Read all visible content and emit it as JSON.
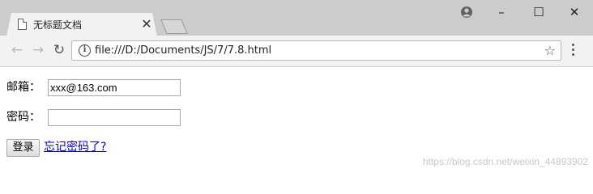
{
  "tab": {
    "title": "无标题文档",
    "close_glyph": "✕"
  },
  "window_controls": {
    "minimize": "–",
    "maximize": "☐",
    "close": "✕"
  },
  "toolbar": {
    "back_glyph": "←",
    "forward_glyph": "→",
    "reload_glyph": "↻",
    "info_glyph": "i",
    "url": "file:///D:/Documents/JS/7/7.8.html",
    "star_glyph": "☆"
  },
  "form": {
    "email_label": "邮箱：",
    "email_value": "xxx@163.com",
    "password_label": "密码：",
    "password_value": "",
    "login_label": "登录",
    "forgot_link": "忘记密码了?"
  },
  "watermark": "https://blog.csdn.net/weixin_44893902",
  "icons": {
    "tab_icon": "document-icon",
    "profile": "account-circle-icon",
    "menu": "more-vertical-icon",
    "info": "info-icon",
    "bookmark": "star-icon"
  },
  "colors": {
    "tabstrip": "#cccccc",
    "active_tab": "#f2f2f2",
    "link": "#0000ee"
  }
}
